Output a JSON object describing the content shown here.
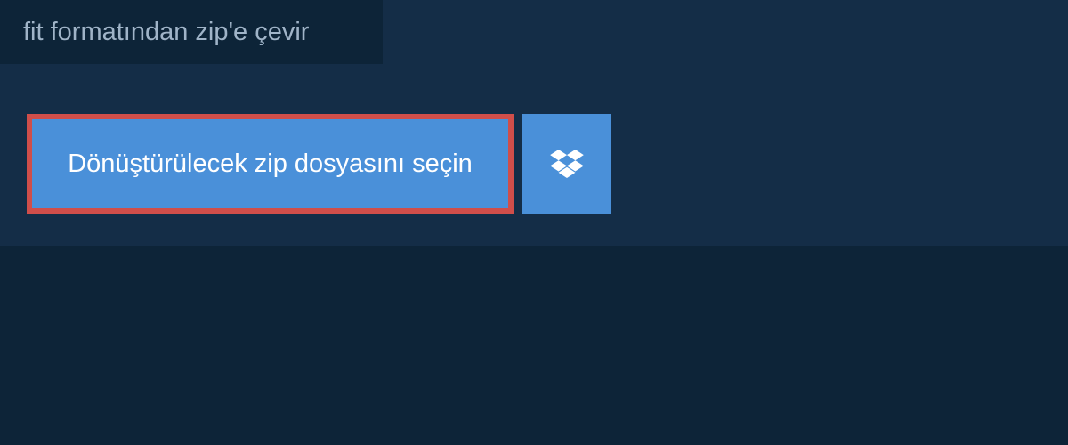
{
  "tab": {
    "label": "fit formatından zip'e çevir"
  },
  "buttons": {
    "select_file_label": "Dönüştürülecek zip dosyasını seçin"
  },
  "colors": {
    "background": "#0d2438",
    "panel": "#142d47",
    "button": "#4a90d9",
    "button_border": "#d04e4a",
    "text_muted": "#a0b4c8",
    "text_white": "#ffffff"
  },
  "icons": {
    "dropbox": "dropbox-icon"
  }
}
